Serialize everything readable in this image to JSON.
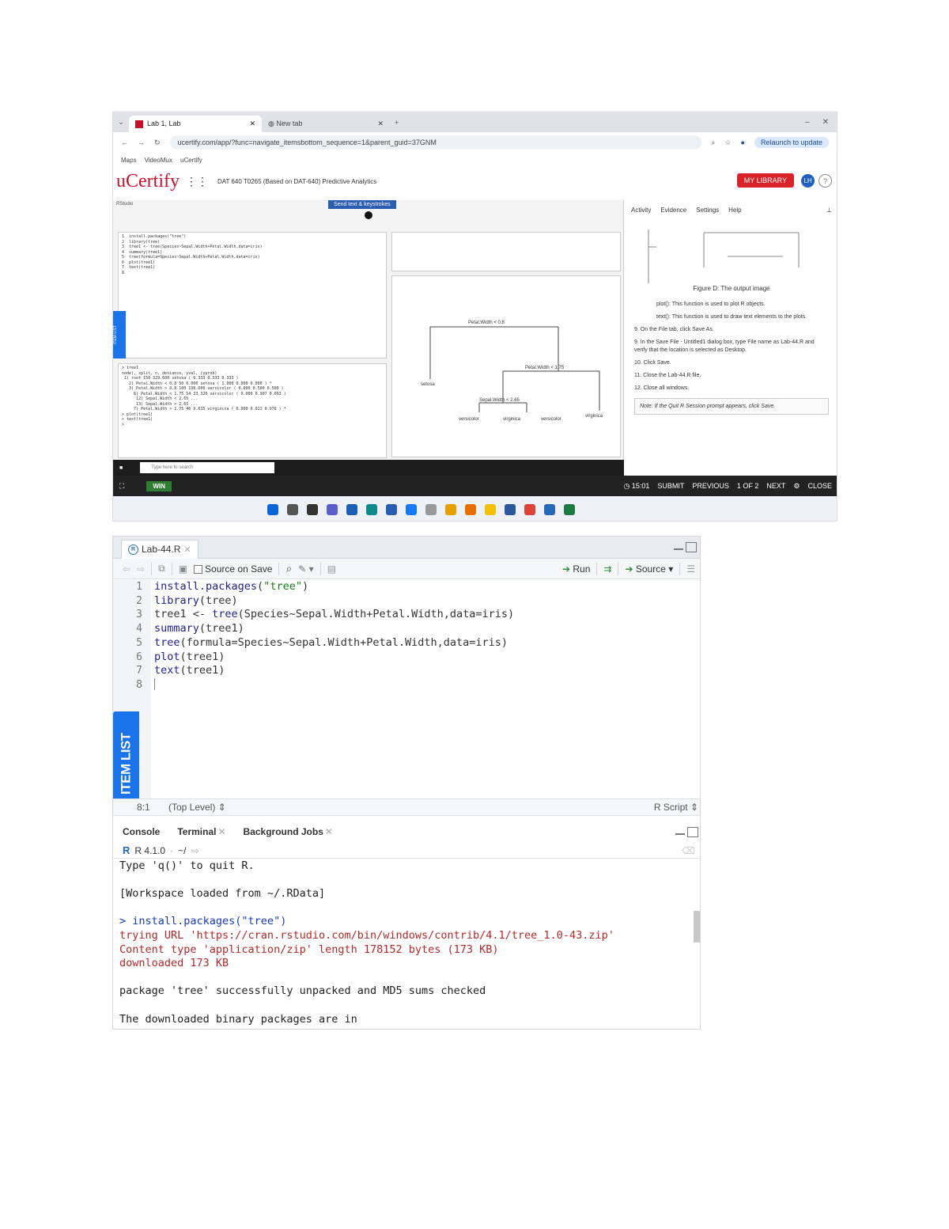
{
  "browser": {
    "tab_active": "Lab 1, Lab",
    "tab_inactive": "New tab",
    "url": "ucertify.com/app/?func=navigate_itemsbottom_sequence=1&parent_guid=37GNM",
    "update_label": "Relaunch to update",
    "bookmarks": [
      "Maps",
      "VideoMux",
      "uCertify"
    ]
  },
  "ucertify": {
    "logo": "uCertify",
    "course": "DAT 640 T0265 (Based on DAT-640) Predictive Analytics",
    "my_library": "MY LIBRARY",
    "avatar": "LH",
    "help": "?",
    "send_keys": "Send text & keystrokes",
    "side_tabs": [
      "Activity",
      "Evidence",
      "Settings",
      "Help"
    ],
    "figure_caption": "Figure D: The output image",
    "steps": [
      "plot(): This function is used to plot R objects.",
      "text(): This function is used to draw text elements to the plots.",
      "9. On the File tab, click Save As.",
      "9. In the Save File - Untitled1 dialog box, type File name as Lab-44.R and verify that the location is selected as Desktop.",
      "10. Click Save.",
      "11. Close the Lab-44.R file.",
      "12. Close all windows."
    ],
    "note": "Note: If the Quit R Session prompt appears, click Save.",
    "bottom_bar": {
      "win": "WIN",
      "timer": "15:01",
      "submit": "SUBMIT",
      "previous": "PREVIOUS",
      "page": "1 OF 2",
      "next": "NEXT",
      "close": "CLOSE"
    },
    "tree_labels": [
      "Petal.Width < 0.8",
      "Petal.Width < 1.75",
      "Sepal.Width < 2.65",
      "setosa",
      "versicolor",
      "virginica",
      "versicolor",
      "virginica"
    ],
    "taskbar_search": "Type here to search"
  },
  "editor": {
    "tab_label": "Lab-44.R",
    "source_on_save": "Source on Save",
    "run": "Run",
    "source": "Source",
    "line_numbers": [
      "1",
      "2",
      "3",
      "4",
      "5",
      "6",
      "7",
      "8"
    ],
    "status_position": "8:1",
    "status_scope": "(Top Level)",
    "status_type": "R Script",
    "item_list": "ITEM LIST"
  },
  "console": {
    "tabs": [
      "Console",
      "Terminal",
      "Background Jobs"
    ],
    "r_version": "R 4.1.0",
    "path": "~/",
    "lines": [
      "Type 'q()' to quit R.",
      "",
      "[Workspace loaded from ~/.RData]",
      "",
      "> install.packages(\"tree\")",
      "trying URL 'https://cran.rstudio.com/bin/windows/contrib/4.1/tree_1.0-43.zip'",
      "Content type 'application/zip' length 178152 bytes (173 KB)",
      "downloaded 173 KB",
      "",
      "package 'tree' successfully unpacked and MD5 sums checked",
      "",
      "The downloaded binary packages are in"
    ]
  },
  "colors": {
    "brand_red": "#c8102e",
    "item_list_blue": "#1a73e8",
    "error_red": "#b52828",
    "input_blue": "#1a3bb8"
  }
}
